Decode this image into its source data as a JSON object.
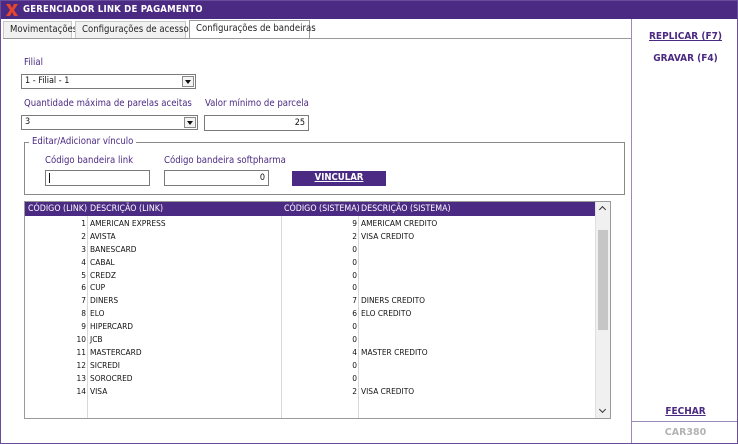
{
  "window": {
    "title": "GERENCIADOR LINK DE PAGAMENTO"
  },
  "tabs": [
    {
      "label": "Movimentações"
    },
    {
      "label": "Configurações de acesso"
    },
    {
      "label": "Configurações de bandeiras"
    }
  ],
  "form": {
    "filial_label": "Filial",
    "filial_value": "1 - Filial - 1",
    "qtd_label": "Quantidade máxima de parelas aceitas",
    "qtd_value": "3",
    "valor_label": "Valor mínimo de parcela",
    "valor_value": "25"
  },
  "group": {
    "title": "Editar/Adicionar vínculo",
    "link_label": "Código bandeira link",
    "link_value": "",
    "soft_label": "Código bandeira softpharma",
    "soft_value": "0",
    "vincular_label": "VINCULAR"
  },
  "grid": {
    "headers": [
      "CÓDIGO (LINK)",
      "DESCRIÇÃO (LINK)",
      "CÓDIGO (SISTEMA)",
      "DESCRIÇÃO (SISTEMA)"
    ],
    "rows": [
      [
        "1",
        "AMERICAN EXPRESS",
        "9",
        "AMERICAM CREDITO"
      ],
      [
        "2",
        "AVISTA",
        "2",
        "VISA CREDITO"
      ],
      [
        "3",
        "BANESCARD",
        "0",
        ""
      ],
      [
        "4",
        "CABAL",
        "0",
        ""
      ],
      [
        "5",
        "CREDZ",
        "0",
        ""
      ],
      [
        "6",
        "CUP",
        "0",
        ""
      ],
      [
        "7",
        "DINERS",
        "7",
        "DINERS CREDITO"
      ],
      [
        "8",
        "ELO",
        "6",
        "ELO CREDITO"
      ],
      [
        "9",
        "HIPERCARD",
        "0",
        ""
      ],
      [
        "10",
        "JCB",
        "0",
        ""
      ],
      [
        "11",
        "MASTERCARD",
        "4",
        "MASTER CREDITO"
      ],
      [
        "12",
        "SICREDI",
        "0",
        ""
      ],
      [
        "13",
        "SOROCRED",
        "0",
        ""
      ],
      [
        "14",
        "VISA",
        "2",
        "VISA CREDITO"
      ]
    ]
  },
  "sidebar": {
    "replicar_label": "REPLICAR (F7)",
    "gravar_label": "GRAVAR (F4)",
    "fechar_label": "FECHAR",
    "screen_code": "CAR380"
  },
  "colors": {
    "brand": "#4b2a83",
    "logo_accent": "#e8452c"
  }
}
